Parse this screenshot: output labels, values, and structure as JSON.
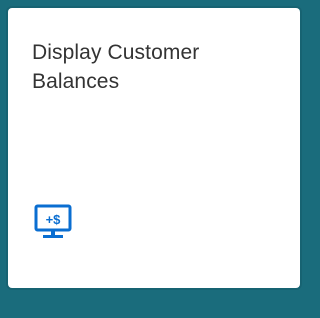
{
  "tile": {
    "title": "Display Customer Balances",
    "icon": "monitor-plus-dollar-icon",
    "icon_text": "+$",
    "icon_color": "#0a6ed1"
  },
  "colors": {
    "background": "#1a6c7c",
    "tile": "#ffffff",
    "title": "#333333"
  }
}
